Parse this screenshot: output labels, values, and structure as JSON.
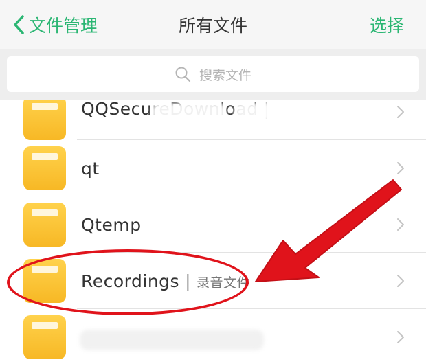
{
  "navbar": {
    "back_label": "文件管理",
    "title": "所有文件",
    "action_label": "选择",
    "accent_color": "#2bb673"
  },
  "search": {
    "placeholder": "搜索文件",
    "icon": "search-icon"
  },
  "folders": [
    {
      "name": "QQSecureDownload",
      "sub": ""
    },
    {
      "name": "qt",
      "sub": ""
    },
    {
      "name": "Qtemp",
      "sub": ""
    },
    {
      "name": "Recordings",
      "sub": "录音文件",
      "highlighted": true
    },
    {
      "name": "",
      "sub": ""
    }
  ],
  "colors": {
    "folder": "#f7b825",
    "annotation": "#e0131b"
  }
}
